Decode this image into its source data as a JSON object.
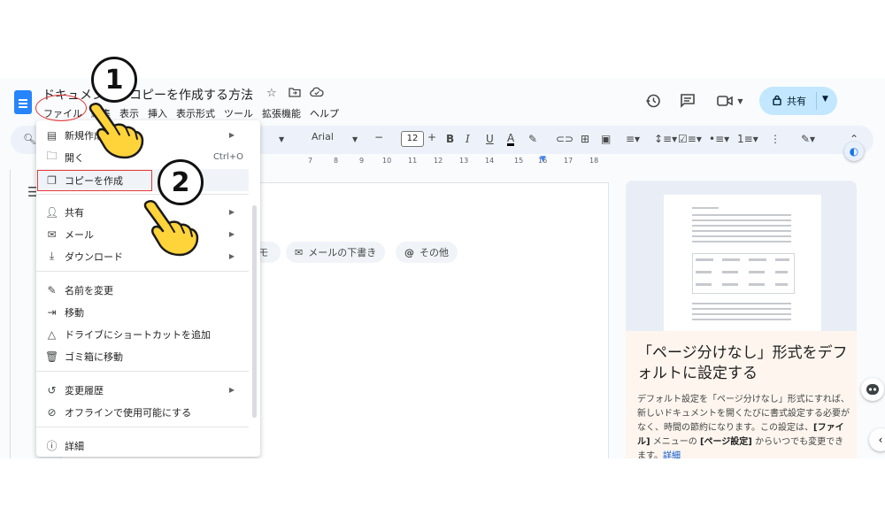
{
  "document": {
    "title": "ドキュメントのコピーを作成する方法",
    "menubar": [
      "ファイル",
      "編集",
      "表示",
      "挿入",
      "表示形式",
      "ツール",
      "拡張機能",
      "ヘルプ"
    ]
  },
  "header": {
    "share_label": "共有"
  },
  "toolbar": {
    "font": "Arial",
    "font_size": "12"
  },
  "ruler_ticks": [
    "7",
    "8",
    "9",
    "10",
    "11",
    "12",
    "13",
    "14",
    "15",
    "16",
    "17",
    "18"
  ],
  "file_menu": {
    "items": [
      {
        "label": "新規作成",
        "icon": "document-icon",
        "submenu": true
      },
      {
        "label": "開く",
        "icon": "folder-icon",
        "shortcut": "Ctrl+O"
      },
      {
        "label": "コピーを作成",
        "icon": "copy-icon",
        "highlighted": true
      },
      {
        "label": "共有",
        "icon": "person-add-icon",
        "submenu": true
      },
      {
        "label": "メール",
        "icon": "mail-icon",
        "submenu": true
      },
      {
        "label": "ダウンロード",
        "icon": "download-icon",
        "submenu": true
      },
      {
        "label": "名前を変更",
        "icon": "rename-icon"
      },
      {
        "label": "移動",
        "icon": "move-folder-icon"
      },
      {
        "label": "ドライブにショートカットを追加",
        "icon": "drive-shortcut-icon"
      },
      {
        "label": "ゴミ箱に移動",
        "icon": "trash-icon"
      },
      {
        "label": "変更履歴",
        "icon": "history-icon",
        "submenu": true
      },
      {
        "label": "オフラインで使用可能にする",
        "icon": "offline-icon"
      },
      {
        "label": "詳細",
        "icon": "info-icon"
      }
    ]
  },
  "chips": [
    "メモ",
    "メールの下書き",
    "その他"
  ],
  "side_card": {
    "title": "「ページ分けなし」形式をデフォルトに設定する",
    "body_line1": "デフォルト設定を「ページ分けなし」形式にすれば、新しいドキュメントを開くたびに書式設定する必要がなく、時間の節約になります。この設定は、",
    "body_bold1": "[ファイル]",
    "body_mid": " メニューの ",
    "body_bold2": "[ページ設定]",
    "body_tail": " からいつでも変更できます。",
    "body_link": "詳細"
  },
  "annotations": {
    "step1": "1",
    "step2": "2"
  }
}
